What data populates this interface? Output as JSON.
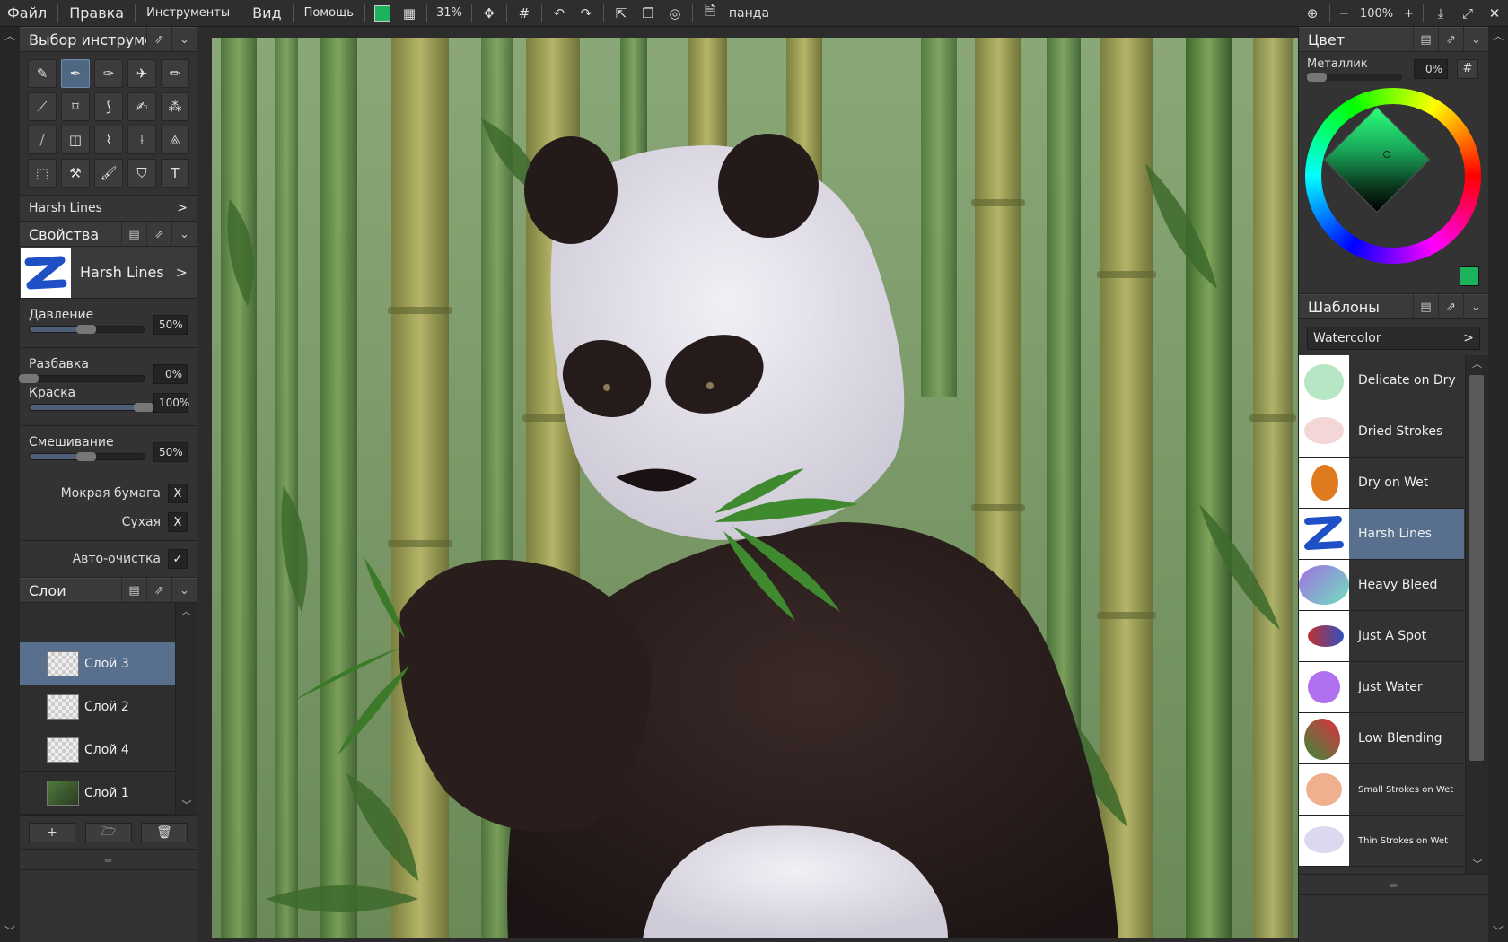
{
  "menu": {
    "file": "Файл",
    "edit": "Правка",
    "tools": "Инструменты",
    "view": "Вид",
    "help": "Помощь",
    "zoom_small": "31%",
    "doc_name": "панда",
    "zoom_label": "100%",
    "zoom_minus": "−",
    "zoom_plus": "+"
  },
  "tools_panel": {
    "title": "Выбор инструме",
    "preset_name": "Harsh Lines",
    "chevron": ">"
  },
  "properties": {
    "title": "Свойства",
    "brush_name": "Harsh Lines",
    "sliders": [
      {
        "label": "Давление",
        "value": "50%",
        "fraction": 0.5
      },
      {
        "label": "Разбавка",
        "value": "0%",
        "fraction": 0.0
      },
      {
        "label": "Краска",
        "value": "100%",
        "fraction": 1.0
      },
      {
        "label": "Смешивание",
        "value": "50%",
        "fraction": 0.5
      }
    ],
    "checks": [
      {
        "label": "Мокрая бумага",
        "mark": "X"
      },
      {
        "label": "Сухая",
        "mark": "X"
      },
      {
        "label": "Авто-очистка",
        "mark": "✓"
      }
    ]
  },
  "layers": {
    "title": "Слои",
    "items": [
      {
        "name": "Слой 3",
        "active": true
      },
      {
        "name": "Слой 2",
        "active": false
      },
      {
        "name": "Слой 4",
        "active": false
      },
      {
        "name": "Слой 1",
        "active": false
      }
    ],
    "add": "+"
  },
  "color_panel": {
    "title": "Цвет",
    "metallic_label": "Металлик",
    "metallic_value": "0%",
    "hash": "#",
    "current_color": "#1db25c"
  },
  "presets_panel": {
    "title": "Шаблоны",
    "category": "Watercolor",
    "items": [
      {
        "name": "Delicate on Dry",
        "active": false
      },
      {
        "name": "Dried Strokes",
        "active": false
      },
      {
        "name": "Dry on Wet",
        "active": false
      },
      {
        "name": "Harsh Lines",
        "active": true
      },
      {
        "name": "Heavy Bleed",
        "active": false
      },
      {
        "name": "Just A Spot",
        "active": false
      },
      {
        "name": "Just Water",
        "active": false
      },
      {
        "name": "Low Blending",
        "active": false
      },
      {
        "name": "Small Strokes on Wet",
        "active": false
      },
      {
        "name": "Thin Strokes on Wet",
        "active": false
      }
    ]
  },
  "colors": {
    "accent": "#58708e",
    "panel": "#333333",
    "active_color": "#1db25c"
  }
}
